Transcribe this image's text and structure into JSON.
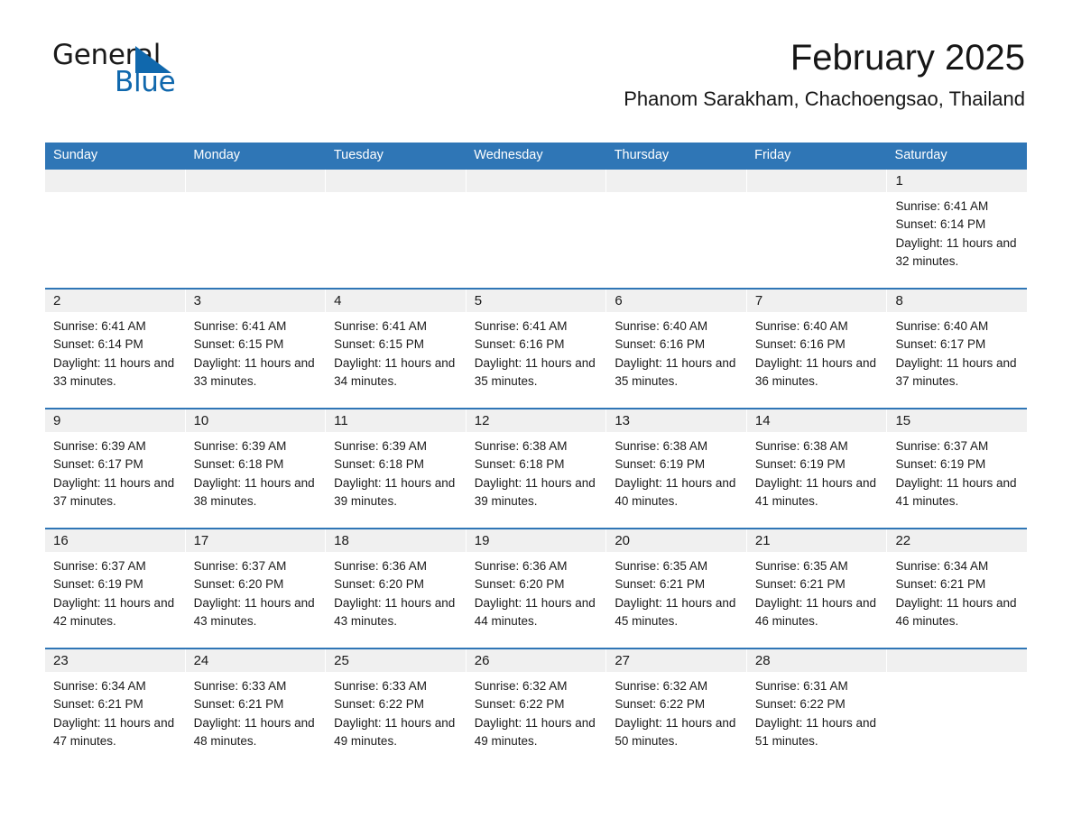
{
  "brand": {
    "name_primary": "General",
    "name_secondary": "Blue",
    "triangle_color": "#1068ad"
  },
  "header": {
    "title": "February 2025",
    "subtitle": "Phanom Sarakham, Chachoengsao, Thailand"
  },
  "theme": {
    "header_blue": "#2f76b6",
    "daynum_band": "#f0f0f0",
    "text": "#1a1a1a"
  },
  "weekdays": [
    "Sunday",
    "Monday",
    "Tuesday",
    "Wednesday",
    "Thursday",
    "Friday",
    "Saturday"
  ],
  "weeks": [
    [
      {
        "day": "",
        "sunrise": "",
        "sunset": "",
        "daylight": ""
      },
      {
        "day": "",
        "sunrise": "",
        "sunset": "",
        "daylight": ""
      },
      {
        "day": "",
        "sunrise": "",
        "sunset": "",
        "daylight": ""
      },
      {
        "day": "",
        "sunrise": "",
        "sunset": "",
        "daylight": ""
      },
      {
        "day": "",
        "sunrise": "",
        "sunset": "",
        "daylight": ""
      },
      {
        "day": "",
        "sunrise": "",
        "sunset": "",
        "daylight": ""
      },
      {
        "day": "1",
        "sunrise": "Sunrise: 6:41 AM",
        "sunset": "Sunset: 6:14 PM",
        "daylight": "Daylight: 11 hours and 32 minutes."
      }
    ],
    [
      {
        "day": "2",
        "sunrise": "Sunrise: 6:41 AM",
        "sunset": "Sunset: 6:14 PM",
        "daylight": "Daylight: 11 hours and 33 minutes."
      },
      {
        "day": "3",
        "sunrise": "Sunrise: 6:41 AM",
        "sunset": "Sunset: 6:15 PM",
        "daylight": "Daylight: 11 hours and 33 minutes."
      },
      {
        "day": "4",
        "sunrise": "Sunrise: 6:41 AM",
        "sunset": "Sunset: 6:15 PM",
        "daylight": "Daylight: 11 hours and 34 minutes."
      },
      {
        "day": "5",
        "sunrise": "Sunrise: 6:41 AM",
        "sunset": "Sunset: 6:16 PM",
        "daylight": "Daylight: 11 hours and 35 minutes."
      },
      {
        "day": "6",
        "sunrise": "Sunrise: 6:40 AM",
        "sunset": "Sunset: 6:16 PM",
        "daylight": "Daylight: 11 hours and 35 minutes."
      },
      {
        "day": "7",
        "sunrise": "Sunrise: 6:40 AM",
        "sunset": "Sunset: 6:16 PM",
        "daylight": "Daylight: 11 hours and 36 minutes."
      },
      {
        "day": "8",
        "sunrise": "Sunrise: 6:40 AM",
        "sunset": "Sunset: 6:17 PM",
        "daylight": "Daylight: 11 hours and 37 minutes."
      }
    ],
    [
      {
        "day": "9",
        "sunrise": "Sunrise: 6:39 AM",
        "sunset": "Sunset: 6:17 PM",
        "daylight": "Daylight: 11 hours and 37 minutes."
      },
      {
        "day": "10",
        "sunrise": "Sunrise: 6:39 AM",
        "sunset": "Sunset: 6:18 PM",
        "daylight": "Daylight: 11 hours and 38 minutes."
      },
      {
        "day": "11",
        "sunrise": "Sunrise: 6:39 AM",
        "sunset": "Sunset: 6:18 PM",
        "daylight": "Daylight: 11 hours and 39 minutes."
      },
      {
        "day": "12",
        "sunrise": "Sunrise: 6:38 AM",
        "sunset": "Sunset: 6:18 PM",
        "daylight": "Daylight: 11 hours and 39 minutes."
      },
      {
        "day": "13",
        "sunrise": "Sunrise: 6:38 AM",
        "sunset": "Sunset: 6:19 PM",
        "daylight": "Daylight: 11 hours and 40 minutes."
      },
      {
        "day": "14",
        "sunrise": "Sunrise: 6:38 AM",
        "sunset": "Sunset: 6:19 PM",
        "daylight": "Daylight: 11 hours and 41 minutes."
      },
      {
        "day": "15",
        "sunrise": "Sunrise: 6:37 AM",
        "sunset": "Sunset: 6:19 PM",
        "daylight": "Daylight: 11 hours and 41 minutes."
      }
    ],
    [
      {
        "day": "16",
        "sunrise": "Sunrise: 6:37 AM",
        "sunset": "Sunset: 6:19 PM",
        "daylight": "Daylight: 11 hours and 42 minutes."
      },
      {
        "day": "17",
        "sunrise": "Sunrise: 6:37 AM",
        "sunset": "Sunset: 6:20 PM",
        "daylight": "Daylight: 11 hours and 43 minutes."
      },
      {
        "day": "18",
        "sunrise": "Sunrise: 6:36 AM",
        "sunset": "Sunset: 6:20 PM",
        "daylight": "Daylight: 11 hours and 43 minutes."
      },
      {
        "day": "19",
        "sunrise": "Sunrise: 6:36 AM",
        "sunset": "Sunset: 6:20 PM",
        "daylight": "Daylight: 11 hours and 44 minutes."
      },
      {
        "day": "20",
        "sunrise": "Sunrise: 6:35 AM",
        "sunset": "Sunset: 6:21 PM",
        "daylight": "Daylight: 11 hours and 45 minutes."
      },
      {
        "day": "21",
        "sunrise": "Sunrise: 6:35 AM",
        "sunset": "Sunset: 6:21 PM",
        "daylight": "Daylight: 11 hours and 46 minutes."
      },
      {
        "day": "22",
        "sunrise": "Sunrise: 6:34 AM",
        "sunset": "Sunset: 6:21 PM",
        "daylight": "Daylight: 11 hours and 46 minutes."
      }
    ],
    [
      {
        "day": "23",
        "sunrise": "Sunrise: 6:34 AM",
        "sunset": "Sunset: 6:21 PM",
        "daylight": "Daylight: 11 hours and 47 minutes."
      },
      {
        "day": "24",
        "sunrise": "Sunrise: 6:33 AM",
        "sunset": "Sunset: 6:21 PM",
        "daylight": "Daylight: 11 hours and 48 minutes."
      },
      {
        "day": "25",
        "sunrise": "Sunrise: 6:33 AM",
        "sunset": "Sunset: 6:22 PM",
        "daylight": "Daylight: 11 hours and 49 minutes."
      },
      {
        "day": "26",
        "sunrise": "Sunrise: 6:32 AM",
        "sunset": "Sunset: 6:22 PM",
        "daylight": "Daylight: 11 hours and 49 minutes."
      },
      {
        "day": "27",
        "sunrise": "Sunrise: 6:32 AM",
        "sunset": "Sunset: 6:22 PM",
        "daylight": "Daylight: 11 hours and 50 minutes."
      },
      {
        "day": "28",
        "sunrise": "Sunrise: 6:31 AM",
        "sunset": "Sunset: 6:22 PM",
        "daylight": "Daylight: 11 hours and 51 minutes."
      },
      {
        "day": "",
        "sunrise": "",
        "sunset": "",
        "daylight": ""
      }
    ]
  ]
}
